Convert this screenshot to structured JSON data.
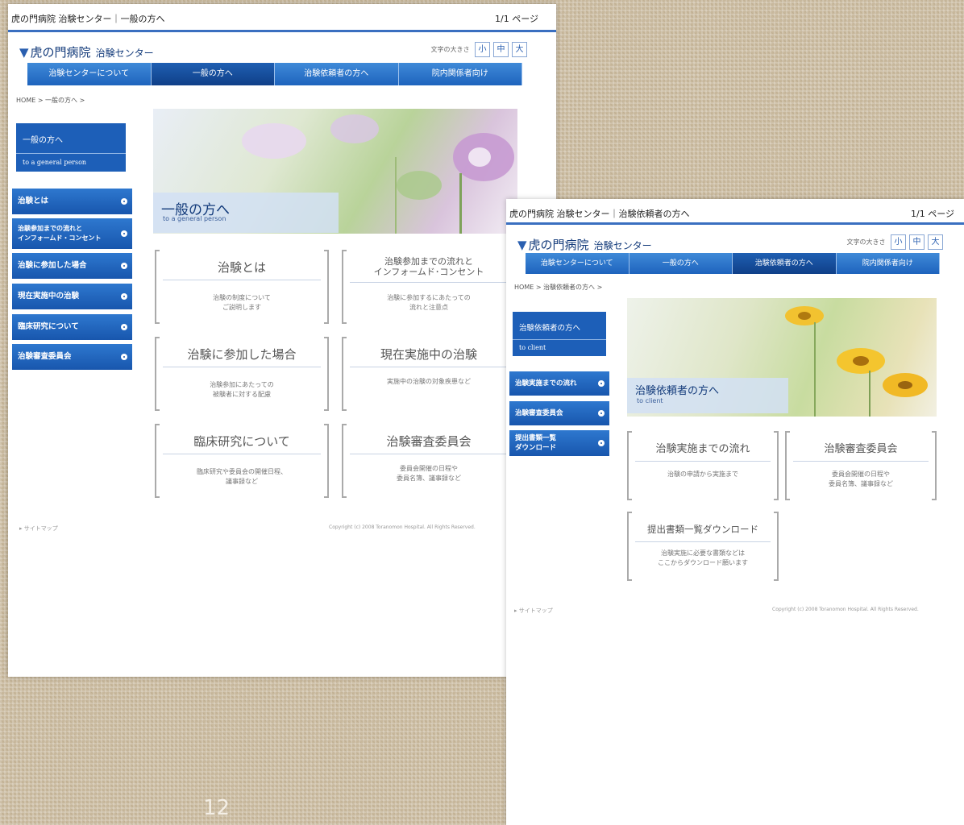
{
  "page1": {
    "header_title": "虎の門病院 治験センター｜一般の方へ",
    "page_count": "1/1 ページ",
    "logo": "虎の門病院",
    "logo_sub": "治験センター",
    "font_size_label": "文字の大きさ",
    "font_buttons": [
      "小",
      "中",
      "大"
    ],
    "nav": [
      "治験センターについて",
      "一般の方へ",
      "治験依頼者の方へ",
      "院内関係者向け"
    ],
    "nav_active_index": 1,
    "breadcrumb": "HOME > 一般の方へ >",
    "side_title": "一般の方へ",
    "side_title_en": "to a general person",
    "side_items": [
      "治験とは",
      "治験参加までの流れと\nインフォームド・コンセント",
      "治験に参加した場合",
      "現在実施中の治験",
      "臨床研究について",
      "治験審査委員会"
    ],
    "hero_title": "一般の方へ",
    "hero_sub": "to a general person",
    "cards": [
      {
        "title": "治験とは",
        "desc": "治験の制度について\nご説明します"
      },
      {
        "title": "治験参加までの流れと\nインフォームド･コンセント",
        "desc": "治験に参加するにあたっての\n流れと注意点"
      },
      {
        "title": "治験に参加した場合",
        "desc": "治験参加にあたっての\n被験者に対する配慮"
      },
      {
        "title": "現在実施中の治験",
        "desc": "実施中の治験の対象疾患など"
      },
      {
        "title": "臨床研究について",
        "desc": "臨床研究や委員会の開催日程、\n議事録など"
      },
      {
        "title": "治験審査委員会",
        "desc": "委員会開催の日程や\n委員名簿、議事録など"
      }
    ],
    "footer_link": "▸ サイトマップ",
    "copyright": "Copyright (c) 2008 Toranomon Hospital. All Rights Reserved."
  },
  "page2": {
    "header_title": "虎の門病院 治験センター｜治験依頼者の方へ",
    "page_count": "1/1 ページ",
    "logo": "虎の門病院",
    "logo_sub": "治験センター",
    "font_size_label": "文字の大きさ",
    "font_buttons": [
      "小",
      "中",
      "大"
    ],
    "nav": [
      "治験センターについて",
      "一般の方へ",
      "治験依頼者の方へ",
      "院内関係者向け"
    ],
    "nav_active_index": 2,
    "breadcrumb": "HOME > 治験依頼者の方へ >",
    "side_title": "治験依頼者の方へ",
    "side_title_en": "to client",
    "side_items": [
      "治験実施までの流れ",
      "治験審査委員会",
      "提出書類一覧\nダウンロード"
    ],
    "hero_title": "治験依頼者の方へ",
    "hero_sub": "to client",
    "cards": [
      {
        "title": "治験実施までの流れ",
        "desc": "治験の申請から実施まで"
      },
      {
        "title": "治験審査委員会",
        "desc": "委員会開催の日程や\n委員名簿、議事録など"
      },
      {
        "title": "提出書類一覧ダウンロード",
        "desc": "治験実施に必要な書類などは\nここからダウンロード願います"
      }
    ],
    "footer_link": "▸ サイトマップ",
    "copyright": "Copyright (c) 2008 Toranomon Hospital. All Rights Reserved."
  },
  "slide_number": "12",
  "colors": {
    "nav_blue": "#1e63bd",
    "nav_active": "#0f3f88",
    "paper": "#ffffff",
    "background": "#c8b89c"
  }
}
